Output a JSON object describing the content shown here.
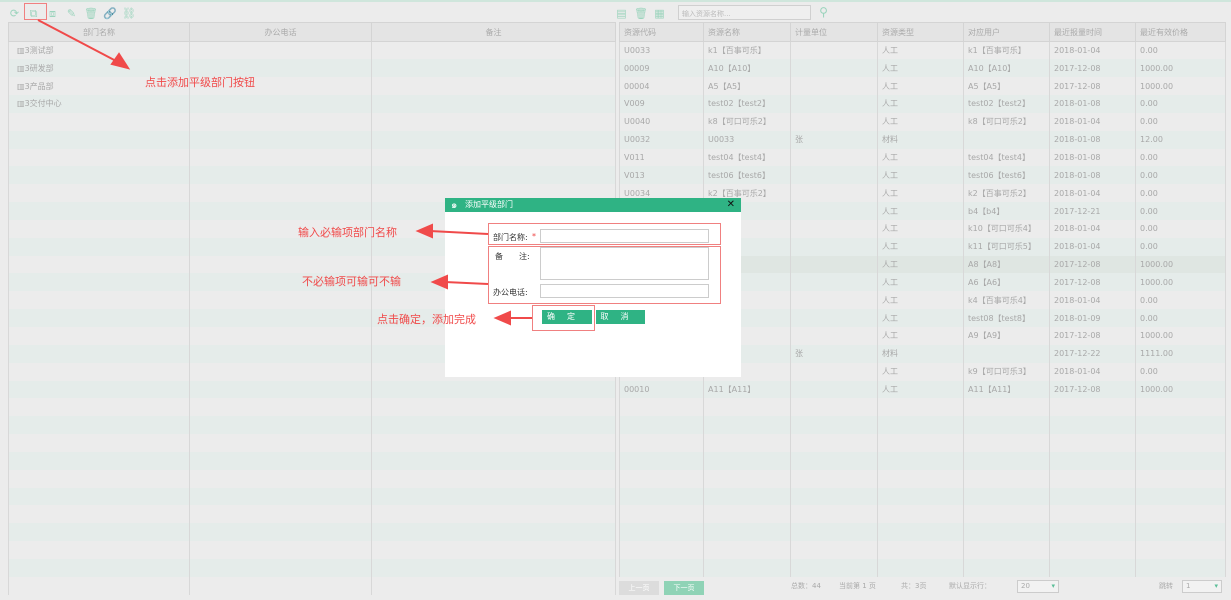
{
  "left_toolbar": [
    "refresh-icon",
    "add-sibling-icon",
    "add-child-icon",
    "edit-icon",
    "delete-icon",
    "link-icon",
    "unlink-icon"
  ],
  "right_toolbar": [
    "add-resource-icon",
    "delete-resource-icon",
    "calculator-icon"
  ],
  "search": {
    "placeholder": "输入资源名称..."
  },
  "dept_table": {
    "headers": [
      "部门名称",
      "办公电话",
      "备注"
    ],
    "rows": [
      "3测试部",
      "3研发部",
      "3产品部",
      "3交付中心"
    ]
  },
  "res_table": {
    "headers": [
      "资源代码",
      "资源名称",
      "计量单位",
      "资源类型",
      "对应用户",
      "最近报量时间",
      "最近有效价格"
    ],
    "rows": [
      [
        "U0033",
        "k1【百事可乐】",
        "",
        "人工",
        "k1【百事可乐】",
        "2018-01-04",
        "0.00"
      ],
      [
        "00009",
        "A10【A10】",
        "",
        "人工",
        "A10【A10】",
        "2017-12-08",
        "1000.00"
      ],
      [
        "00004",
        "A5【A5】",
        "",
        "人工",
        "A5【A5】",
        "2017-12-08",
        "1000.00"
      ],
      [
        "V009",
        "test02【test2】",
        "",
        "人工",
        "test02【test2】",
        "2018-01-08",
        "0.00"
      ],
      [
        "U0040",
        "k8【可口可乐2】",
        "",
        "人工",
        "k8【可口可乐2】",
        "2018-01-04",
        "0.00"
      ],
      [
        "U0032",
        "U0033",
        "张",
        "材料",
        "",
        "2018-01-08",
        "12.00"
      ],
      [
        "V011",
        "test04【test4】",
        "",
        "人工",
        "test04【test4】",
        "2018-01-08",
        "0.00"
      ],
      [
        "V013",
        "test06【test6】",
        "",
        "人工",
        "test06【test6】",
        "2018-01-08",
        "0.00"
      ],
      [
        "U0034",
        "k2【百事可乐2】",
        "",
        "人工",
        "k2【百事可乐2】",
        "2018-01-04",
        "0.00"
      ],
      [
        "",
        "",
        "",
        "人工",
        "b4【b4】",
        "2017-12-21",
        "0.00"
      ],
      [
        "",
        "可乐4】",
        "",
        "人工",
        "k10【可口可乐4】",
        "2018-01-04",
        "0.00"
      ],
      [
        "",
        "可乐5】",
        "",
        "人工",
        "k11【可口可乐5】",
        "2018-01-04",
        "0.00"
      ],
      [
        "",
        "",
        "",
        "人工",
        "A8【A8】",
        "2017-12-08",
        "1000.00"
      ],
      [
        "",
        "",
        "",
        "人工",
        "A6【A6】",
        "2017-12-08",
        "1000.00"
      ],
      [
        "",
        "可乐4】",
        "",
        "人工",
        "k4【百事可乐4】",
        "2018-01-04",
        "0.00"
      ],
      [
        "",
        "est8】",
        "",
        "人工",
        "test08【test8】",
        "2018-01-09",
        "0.00"
      ],
      [
        "",
        "",
        "",
        "人工",
        "A9【A9】",
        "2017-12-08",
        "1000.00"
      ],
      [
        "",
        "W",
        "张",
        "材料",
        "",
        "2017-12-22",
        "1111.00"
      ],
      [
        "",
        "可乐3】",
        "",
        "人工",
        "k9【可口可乐3】",
        "2018-01-04",
        "0.00"
      ],
      [
        "00010",
        "A11【A11】",
        "",
        "人工",
        "A11【A11】",
        "2017-12-08",
        "1000.00"
      ]
    ]
  },
  "pager": {
    "prev": "上一页",
    "next": "下一页",
    "total": "总数：44",
    "current": "当前第 1 页",
    "pages": "共：3页",
    "rows_label": "默认显示行：",
    "rows_value": "20",
    "jump_label": "跳转",
    "jump_value": "1"
  },
  "modal": {
    "title": "添加平级部门",
    "name_label": "部门名称:",
    "required_mark": "*",
    "remark_label": "备　　注:",
    "phone_label": "办公电话:",
    "name_value": "",
    "remark_value": "",
    "phone_value": "",
    "ok": "确定",
    "cancel": "取消"
  },
  "annotations": {
    "a1": "点击添加平级部门按钮",
    "a2": "输入必输项部门名称",
    "a3": "不必输项可输可不输",
    "a4": "点击确定，添加完成"
  },
  "colors": {
    "accent": "#2fb384",
    "annotation": "#f04a4a"
  }
}
